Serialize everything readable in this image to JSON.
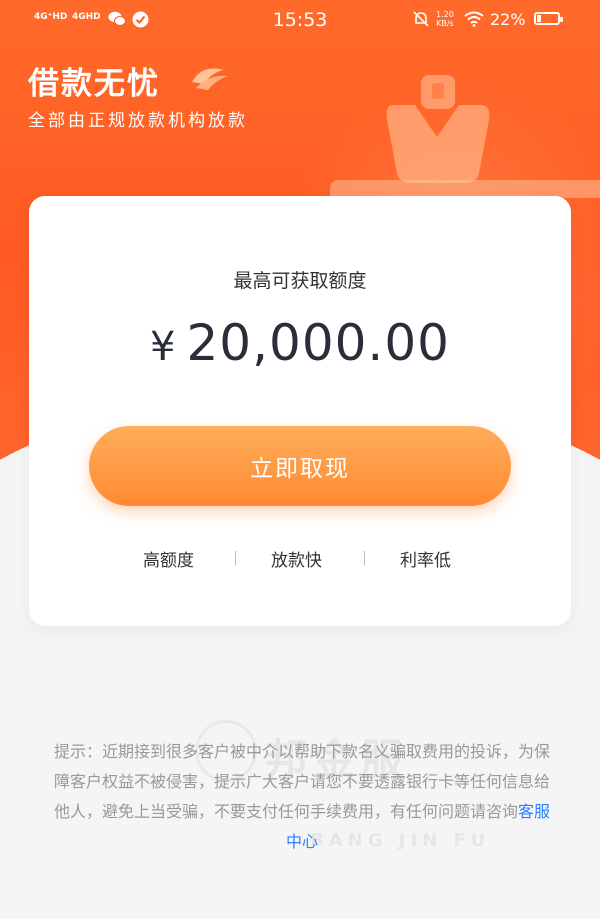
{
  "status_bar": {
    "signal1": "4G⁺HD",
    "signal2": "4GHD",
    "time": "15:53",
    "net_speed_value": "1.20",
    "net_speed_unit": "KB/s",
    "battery_percent": "22%",
    "battery_level": 0.22
  },
  "brand": {
    "title": "借款无忧",
    "subtitle": "全部由正规放款机构放款"
  },
  "card": {
    "label": "最高可获取额度",
    "currency": "¥",
    "amount": "20,000.00",
    "cta_label": "立即取现",
    "features": [
      "高额度",
      "放款快",
      "利率低"
    ]
  },
  "notice": {
    "text": "提示：近期接到很多客户被中介以帮助下款名义骗取费用的投诉，为保障客户权益不被侵害，提示广大客户请您不要透露银行卡等任何信息给他人，避免上当受骗，不要支付任何手续费用，有任何问题请咨询",
    "link": "客服中心"
  },
  "watermark": {
    "text": "邦金服",
    "sub": "BANG JIN FU"
  },
  "colors": {
    "header_orange": "#ff5a22",
    "cta_orange": "#ff8a30",
    "link_blue": "#2a7fff"
  }
}
